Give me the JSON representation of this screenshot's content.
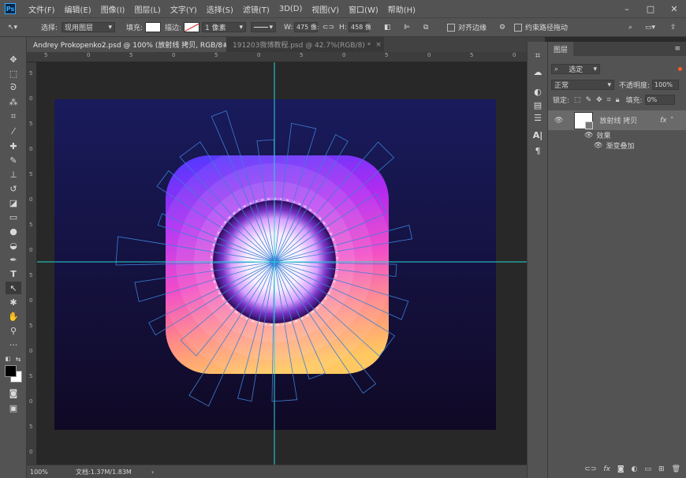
{
  "app": {
    "logo": "Ps"
  },
  "menu": [
    "文件(F)",
    "编辑(E)",
    "图像(I)",
    "图层(L)",
    "文字(Y)",
    "选择(S)",
    "滤镜(T)",
    "3D(D)",
    "视图(V)",
    "窗口(W)",
    "帮助(H)"
  ],
  "options": {
    "select_label": "选择:",
    "select_value": "现用图层",
    "fill_label": "填充:",
    "stroke_label": "描边:",
    "stroke_size": "1 像素",
    "w_label": "W:",
    "w_value": "475 像:",
    "h_label": "H:",
    "h_value": "458 像",
    "align_edges": "对齐边缘",
    "constrain": "约束路径拖动"
  },
  "tabs": [
    {
      "label": "Andrey Prokopenko2.psd @ 100% (放射线 拷贝, RGB/8#) *",
      "close": "×"
    },
    {
      "label": "191203微博教程.psd @ 42.7%(RGB/8) *",
      "close": "×"
    }
  ],
  "rulers": {
    "h": [
      "5",
      "0",
      "5",
      "0",
      "5",
      "0",
      "5",
      "0",
      "5",
      "0",
      "5",
      "0"
    ],
    "v": [
      "5",
      "0",
      "5",
      "0",
      "5",
      "0",
      "5",
      "0",
      "5",
      "0",
      "5",
      "0",
      "5",
      "0",
      "5",
      "0"
    ]
  },
  "status": {
    "zoom": "100%",
    "doc": "文档:1.37M/1.83M",
    "arrow": "›"
  },
  "layers_panel": {
    "title": "图层",
    "filter": "选定",
    "blend": "正常",
    "opacity_label": "不透明度:",
    "opacity": "100%",
    "lock_label": "锁定:",
    "fill_label": "填充:",
    "fill": "0%",
    "layer_name": "放射线 拷贝",
    "fx": "fx",
    "effects": "效果",
    "gradient_overlay": "渐变叠加"
  },
  "colors": {
    "accent": "#31a8ff",
    "guide": "#27d6d6",
    "path": "#3b7fd6",
    "doc_bg_top": "#181a5a",
    "doc_bg_bottom": "#0f0a28"
  }
}
